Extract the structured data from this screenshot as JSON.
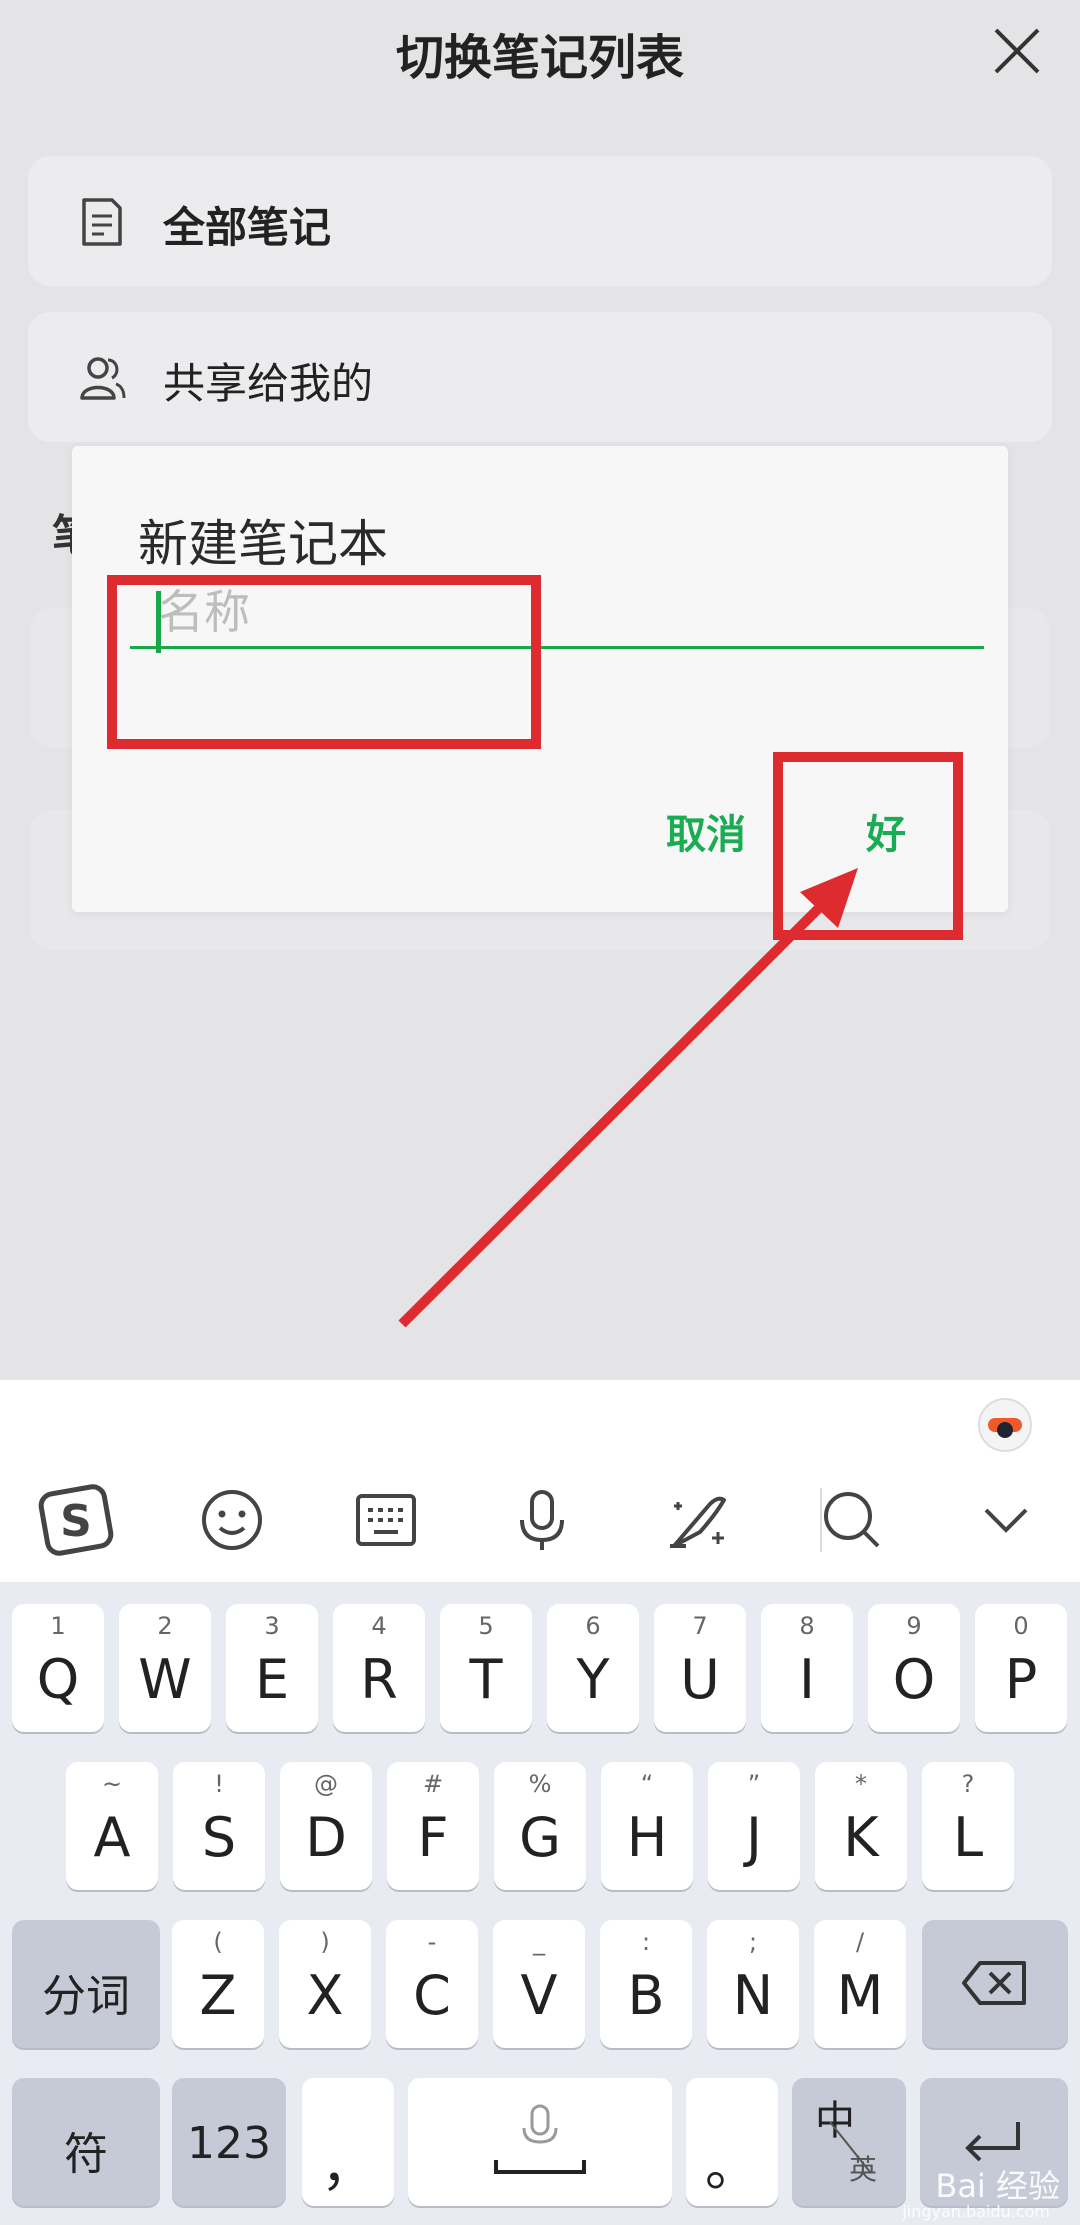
{
  "header": {
    "title": "切换笔记列表"
  },
  "list": {
    "all_notes": "全部笔记",
    "shared": "共享给我的",
    "section_peek": "笔"
  },
  "dialog": {
    "title": "新建笔记本",
    "name_placeholder": "名称",
    "cancel": "取消",
    "ok": "好"
  },
  "keyboard": {
    "row1": [
      {
        "hint": "1",
        "main": "Q"
      },
      {
        "hint": "2",
        "main": "W"
      },
      {
        "hint": "3",
        "main": "E"
      },
      {
        "hint": "4",
        "main": "R"
      },
      {
        "hint": "5",
        "main": "T"
      },
      {
        "hint": "6",
        "main": "Y"
      },
      {
        "hint": "7",
        "main": "U"
      },
      {
        "hint": "8",
        "main": "I"
      },
      {
        "hint": "9",
        "main": "O"
      },
      {
        "hint": "0",
        "main": "P"
      }
    ],
    "row2": [
      {
        "hint": "~",
        "main": "A"
      },
      {
        "hint": "!",
        "main": "S"
      },
      {
        "hint": "@",
        "main": "D"
      },
      {
        "hint": "#",
        "main": "F"
      },
      {
        "hint": "%",
        "main": "G"
      },
      {
        "hint": "“",
        "main": "H"
      },
      {
        "hint": "”",
        "main": "J"
      },
      {
        "hint": "*",
        "main": "K"
      },
      {
        "hint": "?",
        "main": "L"
      }
    ],
    "row3": [
      {
        "hint": "(",
        "main": "Z"
      },
      {
        "hint": ")",
        "main": "X"
      },
      {
        "hint": "-",
        "main": "C"
      },
      {
        "hint": "_",
        "main": "V"
      },
      {
        "hint": ":",
        "main": "B"
      },
      {
        "hint": ";",
        "main": "N"
      },
      {
        "hint": "/",
        "main": "M"
      }
    ],
    "fenci": "分词",
    "fu": "符",
    "num": "123",
    "comma": "，",
    "period": "。",
    "zhong": "中",
    "ying": "英"
  },
  "watermark": {
    "brand": "Bai 经验",
    "site": "jingyan.baidu.com"
  },
  "colors": {
    "accent_green": "#19ac52",
    "annotation_red": "#dd2b2f"
  }
}
